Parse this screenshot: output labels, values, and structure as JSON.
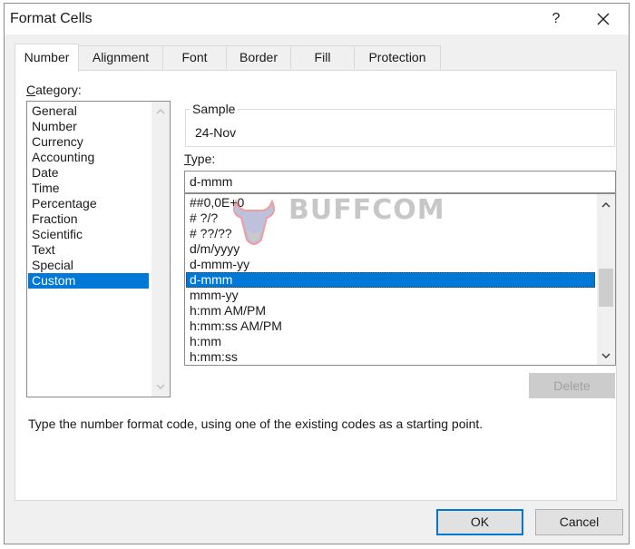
{
  "window": {
    "title": "Format Cells",
    "help_label": "?",
    "close_icon": "close-icon"
  },
  "tabs": [
    {
      "label": "Number",
      "active": true
    },
    {
      "label": "Alignment",
      "active": false
    },
    {
      "label": "Font",
      "active": false
    },
    {
      "label": "Border",
      "active": false
    },
    {
      "label": "Fill",
      "active": false
    },
    {
      "label": "Protection",
      "active": false
    }
  ],
  "category": {
    "label_accel": "C",
    "label_rest": "ategory:",
    "items": [
      "General",
      "Number",
      "Currency",
      "Accounting",
      "Date",
      "Time",
      "Percentage",
      "Fraction",
      "Scientific",
      "Text",
      "Special",
      "Custom"
    ],
    "selected": "Custom"
  },
  "sample": {
    "legend": "Sample",
    "value": "24-Nov"
  },
  "type": {
    "label_accel": "T",
    "label_rest": "ype:",
    "value": "d-mmm",
    "items": [
      "##0,0E+0",
      "# ?/?",
      "# ??/??",
      "d/m/yyyy",
      "d-mmm-yy",
      "d-mmm",
      "mmm-yy",
      "h:mm AM/PM",
      "h:mm:ss AM/PM",
      "h:mm",
      "h:mm:ss"
    ],
    "selected": "d-mmm"
  },
  "delete_label": "Delete",
  "hint": "Type the number format code, using one of the existing codes as a starting point.",
  "buttons": {
    "ok": "OK",
    "cancel": "Cancel"
  },
  "watermark": {
    "text": "BUFFCOM"
  },
  "colors": {
    "accent": "#0078d7",
    "dialog_bg": "#f0f0f0",
    "disabled_button": "#cccccc"
  }
}
